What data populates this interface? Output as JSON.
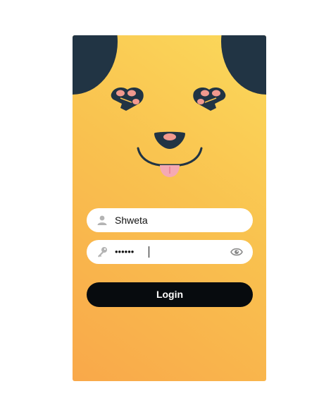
{
  "login_form": {
    "username": {
      "value": "Shweta",
      "icon": "user-icon"
    },
    "password": {
      "masked_value": "••••••",
      "icon": "key-icon",
      "toggle_icon": "eye-icon"
    },
    "login_label": "Login"
  },
  "colors": {
    "gradient_start": "#f9a84a",
    "gradient_end": "#fbd95b",
    "ears": "#213444",
    "button": "#070b0e",
    "tongue": "#f5a9b3"
  }
}
